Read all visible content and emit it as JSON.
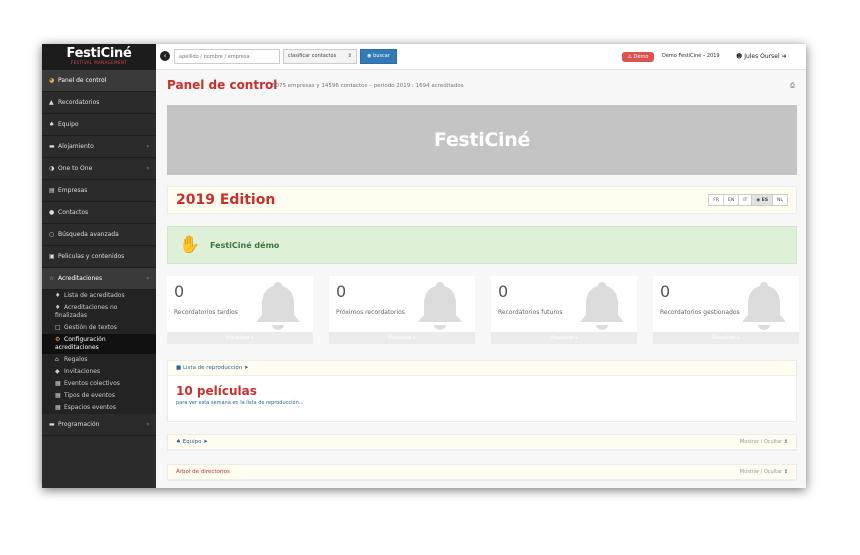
{
  "logo": {
    "title": "FestiCiné",
    "subtitle": "FESTIVAL MANAGEMENT"
  },
  "topbar": {
    "search_placeholder": "apellido / nombre / empresa",
    "sort_label": "clasificar contactos",
    "search_button": "buscar",
    "demo_badge": "Démo",
    "demo_name": "Démo FestiCiné – 2019",
    "user_name": "Jules Oursel"
  },
  "sidebar": {
    "items": [
      {
        "label": "Panel de control",
        "icon": "dashboard-icon",
        "glyph": "◕",
        "active": true,
        "chevron": false
      },
      {
        "label": "Recordatorios",
        "icon": "bell-icon",
        "glyph": "▲",
        "active": false,
        "chevron": false
      },
      {
        "label": "Equipo",
        "icon": "team-icon",
        "glyph": "♠",
        "active": false,
        "chevron": false
      },
      {
        "label": "Alojamiento",
        "icon": "bed-icon",
        "glyph": "▬",
        "active": false,
        "chevron": true
      },
      {
        "label": "One to One",
        "icon": "chat-icon",
        "glyph": "◑",
        "active": false,
        "chevron": true
      },
      {
        "label": "Empresas",
        "icon": "building-icon",
        "glyph": "▤",
        "active": false,
        "chevron": false
      },
      {
        "label": "Contactos",
        "icon": "user-icon",
        "glyph": "●",
        "active": false,
        "chevron": false
      },
      {
        "label": "Búsqueda avanzada",
        "icon": "search-icon",
        "glyph": "○",
        "active": false,
        "chevron": false
      },
      {
        "label": "Peliculas y contenidos",
        "icon": "film-icon",
        "glyph": "▣",
        "active": false,
        "chevron": false
      },
      {
        "label": "Acreditaciones",
        "icon": "accreditation-icon",
        "glyph": "☆",
        "active": true,
        "chevron": true
      }
    ],
    "subitems": [
      {
        "label": "Lista de acreditados",
        "icon": "users-icon",
        "glyph": "♦",
        "active": false
      },
      {
        "label": "Acreditaciones no finalizadas",
        "icon": "users-icon",
        "glyph": "♦",
        "active": false
      },
      {
        "label": "Gestión de textos",
        "icon": "file-icon",
        "glyph": "□",
        "active": false
      },
      {
        "label": "Configuración acreditaciones",
        "icon": "cogs-icon",
        "glyph": "⚙",
        "active": true
      },
      {
        "label": "Regalos",
        "icon": "gift-icon",
        "glyph": "⌂",
        "active": false
      },
      {
        "label": "Invitaciones",
        "icon": "ticket-icon",
        "glyph": "◆",
        "active": false
      },
      {
        "label": "Eventos colectivos",
        "icon": "calendar-icon",
        "glyph": "▦",
        "active": false
      },
      {
        "label": "Tipos de eventos",
        "icon": "calendar-icon",
        "glyph": "▦",
        "active": false
      },
      {
        "label": "Espacios eventos",
        "icon": "calendar-icon",
        "glyph": "▦",
        "active": false
      }
    ],
    "last_item": {
      "label": "Programación",
      "icon": "video-icon",
      "glyph": "▬"
    }
  },
  "main": {
    "title": "Panel de control",
    "stats": "5075 empresas y 14596 contactos – periodo 2019 : 1694 acreditados",
    "banner_text": "FestiCiné",
    "edition_title": "2019 Edition",
    "languages": [
      {
        "code": "FR",
        "selected": false
      },
      {
        "code": "EN",
        "selected": false
      },
      {
        "code": "IT",
        "selected": false
      },
      {
        "code": "ES",
        "selected": true
      },
      {
        "code": "NL",
        "selected": false
      }
    ],
    "welcome_text": "FestiCiné démo",
    "reminder_cards": [
      {
        "count": "0",
        "label": "Recordatorios tardíos",
        "footer": "Visualizar"
      },
      {
        "count": "0",
        "label": "Próximos recordatorios",
        "footer": "Visualizar"
      },
      {
        "count": "0",
        "label": "Recordatorios futuros",
        "footer": "Visualizar"
      },
      {
        "count": "0",
        "label": "Recordatorios gestionados",
        "footer": "Visualizar"
      }
    ],
    "playlist_panel": {
      "header": "Lista de reproducción",
      "count_text": "10 películas",
      "subtext": "para ver esta semana en la lista de reproducción..."
    },
    "team_panel": {
      "header": "Equipo",
      "toggle": "Mostrar / Ocultar"
    },
    "tree_panel": {
      "header": "Árbol de directorios",
      "toggle": "Mostrar / Ocultar"
    }
  },
  "colors": {
    "sidebar": "#2b2b2b",
    "accent_red": "#c9302c",
    "primary_blue": "#337ab7",
    "success_green": "#dff0d8",
    "banner_gray": "#c4c4c4"
  }
}
